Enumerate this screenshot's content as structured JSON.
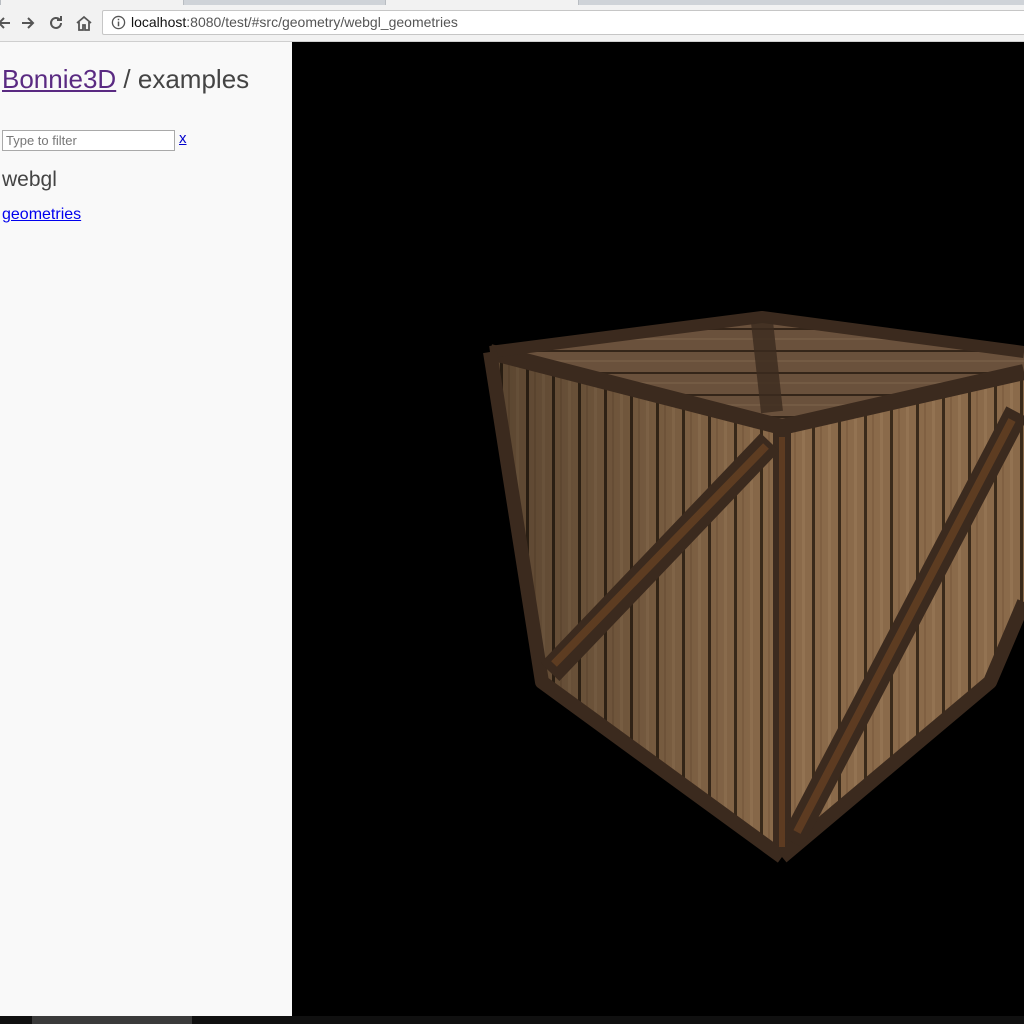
{
  "browser": {
    "url_host": "localhost",
    "url_rest": ":8080/test/#src/geometry/webgl_geometries"
  },
  "sidebar": {
    "title_link": "Bonnie3D",
    "title_rest": " / examples",
    "filter_placeholder": "Type to filter",
    "filter_clear": "x",
    "section_heading": "webgl",
    "example_link": "geometries"
  },
  "viewport": {
    "background": "#000000",
    "object": "wooden-crate"
  }
}
